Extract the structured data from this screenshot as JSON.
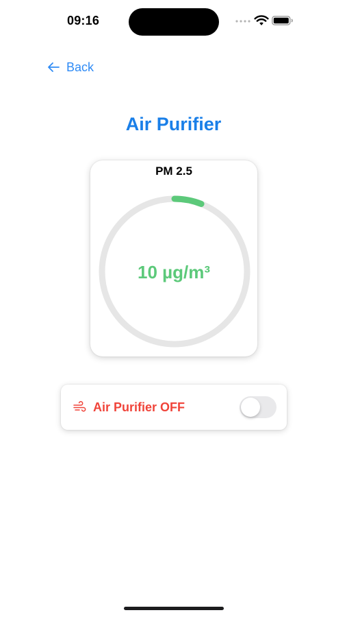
{
  "status_bar": {
    "time": "09:16",
    "icons": [
      "signal-dots-icon",
      "wifi-icon",
      "battery-icon"
    ]
  },
  "nav": {
    "back_label": "Back",
    "back_icon": "arrow-left-icon"
  },
  "title": "Air Purifier",
  "pm_card": {
    "label": "PM 2.5",
    "value_text": "10 µg/m³",
    "gauge_fraction": 0.06,
    "colors": {
      "track": "#e6e6e6",
      "progress": "#5cc97a"
    }
  },
  "purifier": {
    "label": "Air Purifier OFF",
    "icon": "wind-icon",
    "enabled": false,
    "colors": {
      "label": "#f0443a",
      "switch_off": "#e9e9eb"
    }
  },
  "colors": {
    "accent": "#2f8bf5",
    "title": "#1a7fe8"
  }
}
